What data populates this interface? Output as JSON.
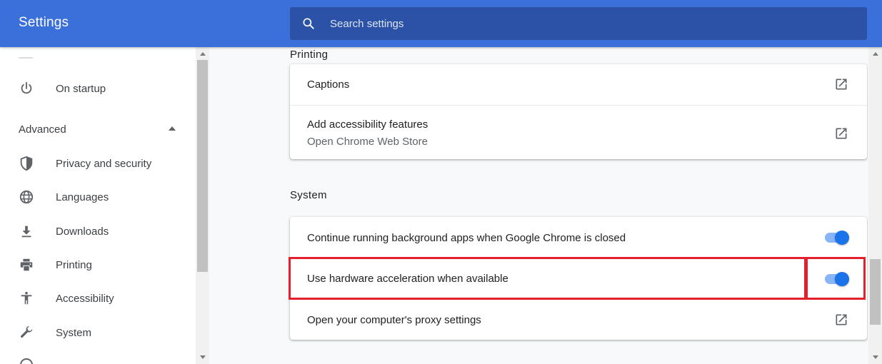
{
  "header": {
    "title": "Settings",
    "search_placeholder": "Search settings",
    "search_icon": "search-icon"
  },
  "sidebar": {
    "on_startup": {
      "label": "On startup",
      "icon": "power-icon"
    },
    "advanced": {
      "label": "Advanced",
      "icon": "arrow-up-icon",
      "expanded": true
    },
    "items": [
      {
        "label": "Privacy and security",
        "icon": "shield-icon"
      },
      {
        "label": "Languages",
        "icon": "globe-icon"
      },
      {
        "label": "Downloads",
        "icon": "download-icon"
      },
      {
        "label": "Printing",
        "icon": "printer-icon"
      },
      {
        "label": "Accessibility",
        "icon": "accessibility-icon"
      },
      {
        "label": "System",
        "icon": "wrench-icon"
      }
    ]
  },
  "main": {
    "printing_section": {
      "title": "Printing"
    },
    "accessibility_card": {
      "rows": [
        {
          "label": "Captions",
          "icon": "open-in-new-icon"
        },
        {
          "label": "Add accessibility features",
          "sublabel": "Open Chrome Web Store",
          "icon": "open-in-new-icon"
        }
      ]
    },
    "system_section": {
      "title": "System",
      "rows": [
        {
          "label": "Continue running background apps when Google Chrome is closed",
          "control": "toggle",
          "enabled": true
        },
        {
          "label": "Use hardware acceleration when available",
          "control": "toggle",
          "enabled": true,
          "highlighted": true
        },
        {
          "label": "Open your computer's proxy settings",
          "icon": "open-in-new-icon"
        }
      ]
    }
  },
  "colors": {
    "header": "#3b6fd9",
    "search": "#2b52a6",
    "toggle_on": "#1a73e8",
    "toggle_track": "#8ab4f8",
    "highlight": "#e3202b"
  }
}
